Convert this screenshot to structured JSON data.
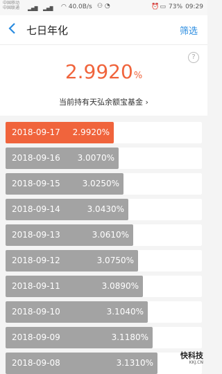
{
  "status": {
    "carrier1": "中国移动",
    "carrier2": "中国联通",
    "network_speed": "40.0B/s",
    "battery": "73%",
    "time": "09:29"
  },
  "header": {
    "title": "七日年化",
    "filter_label": "筛选"
  },
  "summary": {
    "rate": "2.9920",
    "percent": "%",
    "fund_text": "当前持有天弘余额宝基金",
    "help": "?"
  },
  "list": [
    {
      "date": "2018-09-17",
      "rate": "2.9920%",
      "fill": 0.55,
      "active": true
    },
    {
      "date": "2018-09-16",
      "rate": "3.0070%",
      "fill": 0.575,
      "active": false
    },
    {
      "date": "2018-09-15",
      "rate": "3.0250%",
      "fill": 0.6,
      "active": false
    },
    {
      "date": "2018-09-14",
      "rate": "3.0430%",
      "fill": 0.625,
      "active": false
    },
    {
      "date": "2018-09-13",
      "rate": "3.0610%",
      "fill": 0.65,
      "active": false
    },
    {
      "date": "2018-09-12",
      "rate": "3.0750%",
      "fill": 0.675,
      "active": false
    },
    {
      "date": "2018-09-11",
      "rate": "3.0890%",
      "fill": 0.7,
      "active": false
    },
    {
      "date": "2018-09-10",
      "rate": "3.1040%",
      "fill": 0.725,
      "active": false
    },
    {
      "date": "2018-09-09",
      "rate": "3.1180%",
      "fill": 0.75,
      "active": false
    },
    {
      "date": "2018-09-08",
      "rate": "3.1310%",
      "fill": 0.775,
      "active": false
    }
  ],
  "watermark": {
    "brand": "快科技",
    "url": "KKJ.CN"
  },
  "colors": {
    "accent": "#f0643c",
    "link": "#2a8ce0",
    "bar": "#a3a3a3"
  }
}
